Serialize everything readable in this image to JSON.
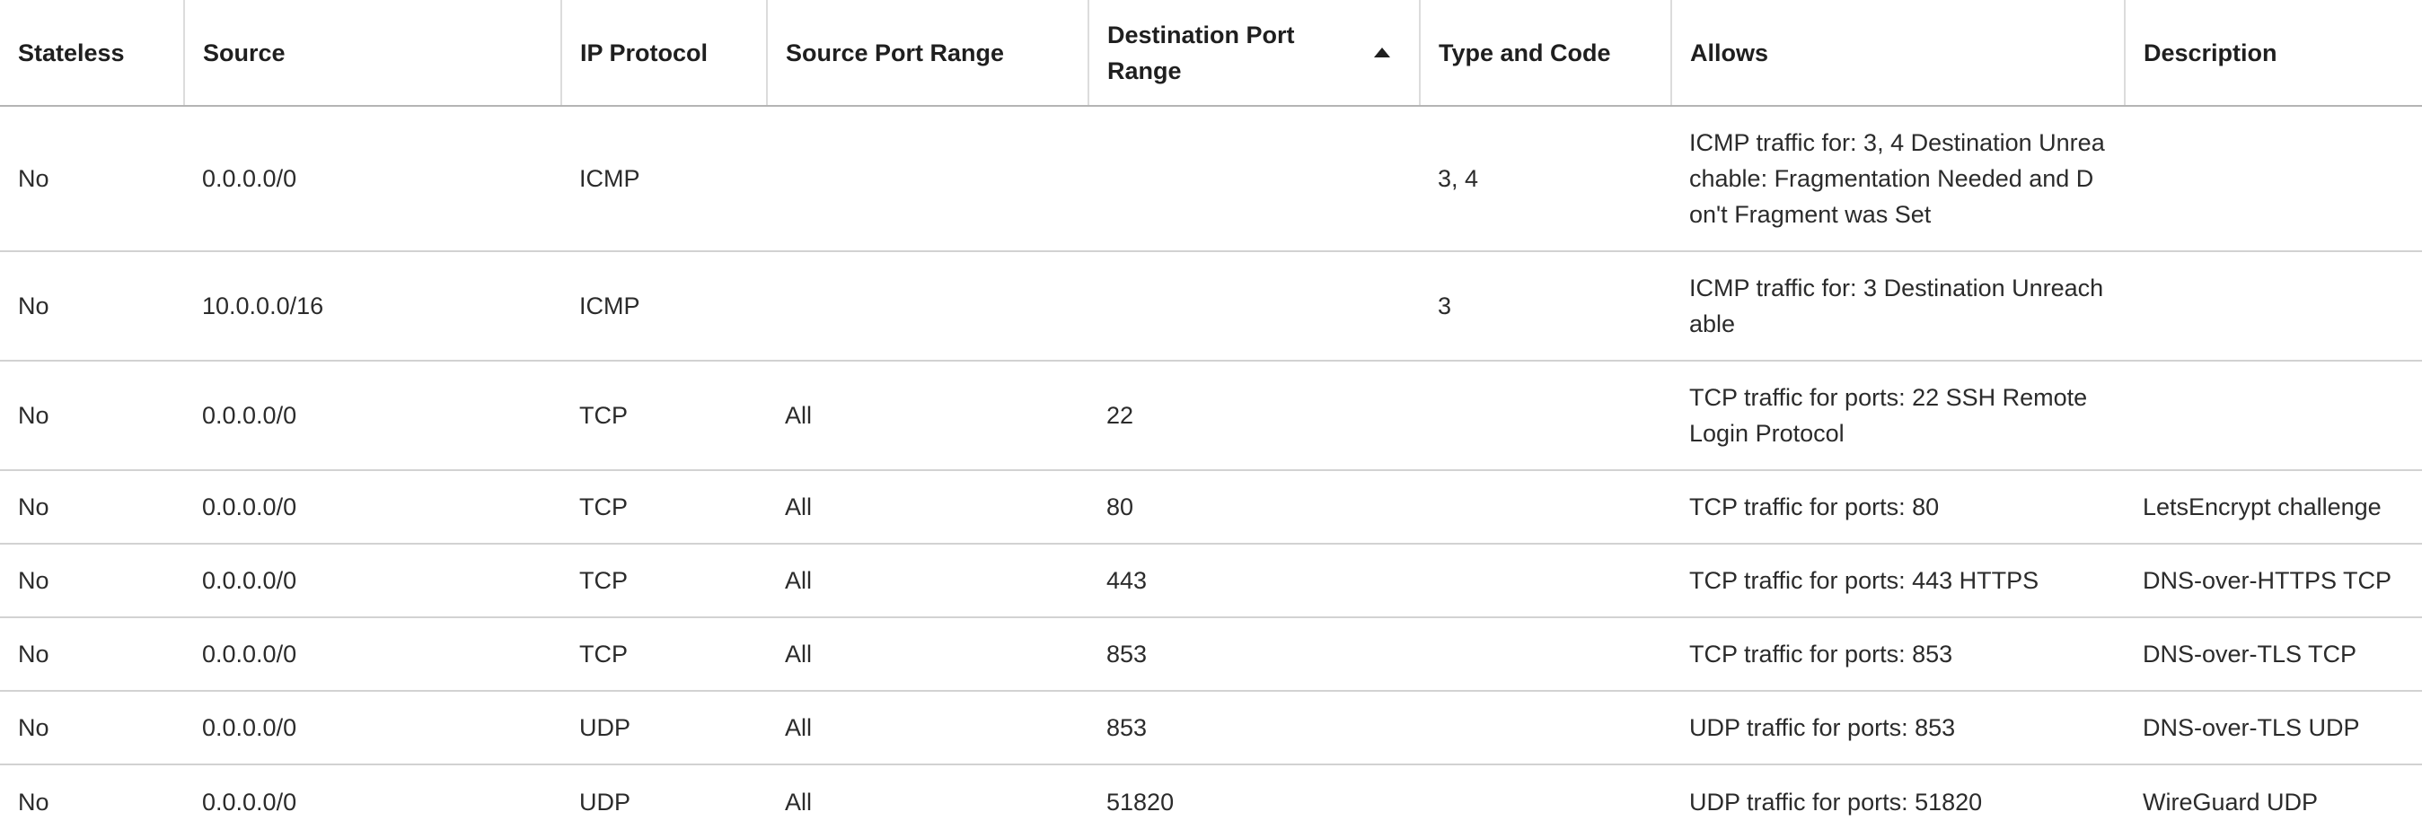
{
  "table": {
    "headers": {
      "stateless": "Stateless",
      "source": "Source",
      "ip_protocol": "IP Protocol",
      "source_port_range": "Source Port Range",
      "destination_port_range": "Destination Port Range",
      "type_and_code": "Type and Code",
      "allows": "Allows",
      "description": "Description"
    },
    "sort": {
      "column": "destination_port_range",
      "direction": "ascending",
      "icon": "caret-up-icon"
    },
    "rows": [
      {
        "stateless": "No",
        "source": "0.0.0.0/0",
        "ip_protocol": "ICMP",
        "source_port_range": "",
        "destination_port_range": "",
        "type_and_code": "3, 4",
        "allows": "ICMP traffic for: 3, 4 Destination Unreachable: Fragmentation Needed and Don't Fragment was Set",
        "description": ""
      },
      {
        "stateless": "No",
        "source": "10.0.0.0/16",
        "ip_protocol": "ICMP",
        "source_port_range": "",
        "destination_port_range": "",
        "type_and_code": "3",
        "allows": "ICMP traffic for: 3 Destination Unreachable",
        "description": ""
      },
      {
        "stateless": "No",
        "source": "0.0.0.0/0",
        "ip_protocol": "TCP",
        "source_port_range": "All",
        "destination_port_range": "22",
        "type_and_code": "",
        "allows": "TCP traffic for ports: 22 SSH Remote Login Protocol",
        "description": ""
      },
      {
        "stateless": "No",
        "source": "0.0.0.0/0",
        "ip_protocol": "TCP",
        "source_port_range": "All",
        "destination_port_range": "80",
        "type_and_code": "",
        "allows": "TCP traffic for ports: 80",
        "description": "LetsEncrypt challenge"
      },
      {
        "stateless": "No",
        "source": "0.0.0.0/0",
        "ip_protocol": "TCP",
        "source_port_range": "All",
        "destination_port_range": "443",
        "type_and_code": "",
        "allows": "TCP traffic for ports: 443 HTTPS",
        "description": "DNS-over-HTTPS TCP"
      },
      {
        "stateless": "No",
        "source": "0.0.0.0/0",
        "ip_protocol": "TCP",
        "source_port_range": "All",
        "destination_port_range": "853",
        "type_and_code": "",
        "allows": "TCP traffic for ports: 853",
        "description": "DNS-over-TLS TCP"
      },
      {
        "stateless": "No",
        "source": "0.0.0.0/0",
        "ip_protocol": "UDP",
        "source_port_range": "All",
        "destination_port_range": "853",
        "type_and_code": "",
        "allows": "UDP traffic for ports: 853",
        "description": "DNS-over-TLS UDP"
      },
      {
        "stateless": "No",
        "source": "0.0.0.0/0",
        "ip_protocol": "UDP",
        "source_port_range": "All",
        "destination_port_range": "51820",
        "type_and_code": "",
        "allows": "UDP traffic for ports: 51820",
        "description": "WireGuard UDP"
      }
    ]
  }
}
